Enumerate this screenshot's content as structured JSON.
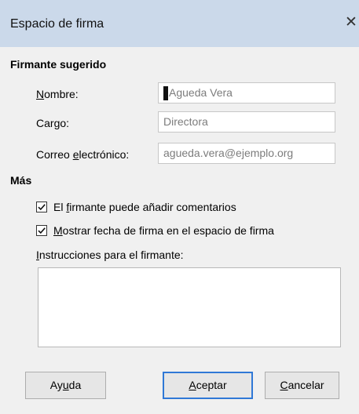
{
  "dialog": {
    "title": "Espacio de firma",
    "close_glyph": "✕"
  },
  "signer": {
    "section_label": "Firmante sugerido",
    "name_label": "Nombre:",
    "name_value": "Agueda Vera",
    "role_label": "Cargo:",
    "role_value": "Directora",
    "email_label": "Correo electrónico:",
    "email_value": "agueda.vera@ejemplo.org"
  },
  "more": {
    "section_label": "Más",
    "allow_comments_label": "El firmante puede añadir comentarios",
    "allow_comments_checked": true,
    "show_date_label": "Mostrar fecha de firma en el espacio de firma",
    "show_date_checked": true,
    "instructions_label": "Instrucciones para el firmante:",
    "instructions_value": ""
  },
  "buttons": {
    "help": "Ayuda",
    "accept": "Aceptar",
    "cancel": "Cancelar"
  }
}
